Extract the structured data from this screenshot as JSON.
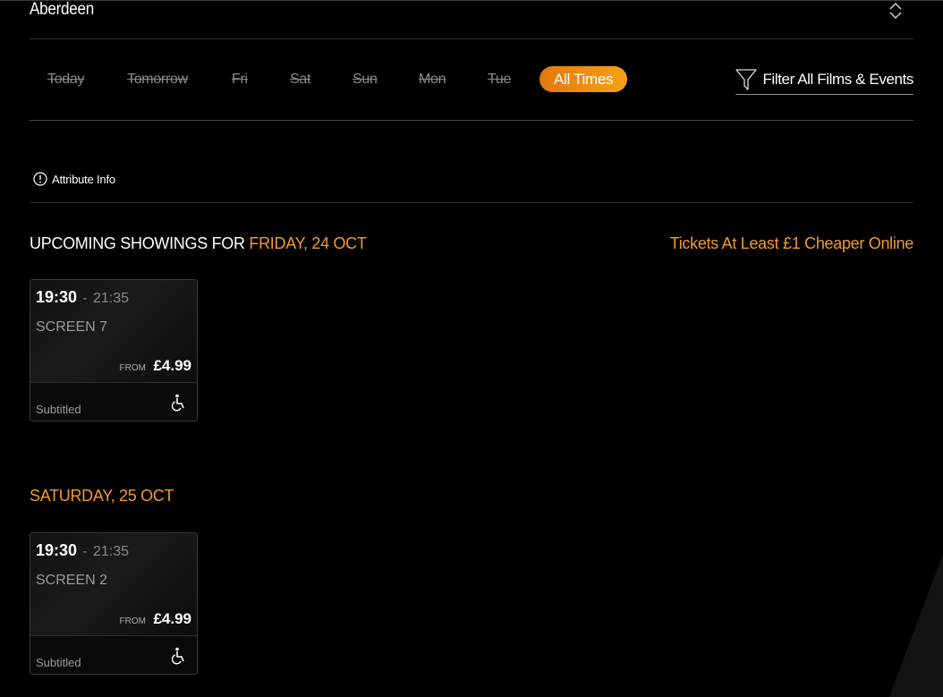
{
  "location": {
    "name": "Aberdeen",
    "toggle_icon": "chevron-updown-icon"
  },
  "date_tabs": [
    {
      "label": "Today"
    },
    {
      "label": "Tomorrow"
    },
    {
      "label": "Fri"
    },
    {
      "label": "Sat"
    },
    {
      "label": "Sun"
    },
    {
      "label": "Mon"
    },
    {
      "label": "Tue"
    },
    {
      "label": "All Times",
      "active": true
    }
  ],
  "filter": {
    "label": "Filter All Films & Events",
    "icon": "funnel-icon"
  },
  "attribute_info": {
    "label": "Attribute Info",
    "icon": "info-icon"
  },
  "heading_prefix": "UPCOMING SHOWINGS FOR ",
  "promo": "Tickets At Least £1 Cheaper Online",
  "days": [
    {
      "date_label": "FRIDAY, 24 OCT",
      "showings": [
        {
          "start": "19:30",
          "separator": "-",
          "end": "21:35",
          "screen": "SCREEN 7",
          "from_label": "FROM",
          "price": "£4.99",
          "attribute": "Subtitled",
          "accessibility_icon": "wheelchair-icon"
        }
      ]
    },
    {
      "date_label": "SATURDAY, 25 OCT",
      "showings": [
        {
          "start": "19:30",
          "separator": "-",
          "end": "21:35",
          "screen": "SCREEN 2",
          "from_label": "FROM",
          "price": "£4.99",
          "attribute": "Subtitled",
          "accessibility_icon": "wheelchair-icon"
        }
      ]
    }
  ],
  "colors": {
    "accent": "#f29a2e",
    "tab_gradient_start": "#e2780d",
    "tab_gradient_end": "#f6a216",
    "background": "#000000",
    "muted_text": "#8a8a8a"
  }
}
